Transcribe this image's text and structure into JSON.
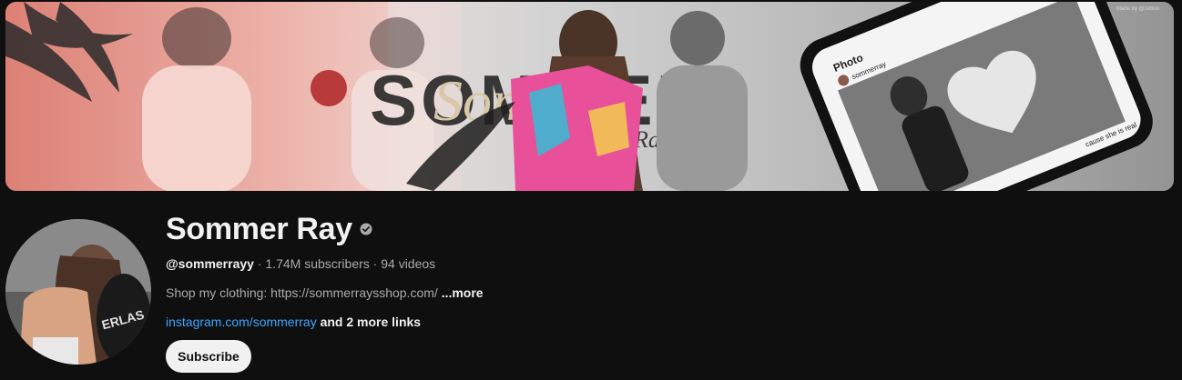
{
  "banner": {
    "wordmark": "SOMMER",
    "script_word": "Sommer",
    "script_sub": "Ray",
    "phone_header": "Photo",
    "phone_username": "sommerray",
    "phone_caption": "cause she is real",
    "watermark": "Made by @zeboo",
    "colors": {
      "left_tint": "#e58e82",
      "right_tint": "#9e9e9e"
    }
  },
  "channel": {
    "name": "Sommer Ray",
    "verified_icon": "verified-check-icon",
    "handle": "@sommerrayy",
    "subscribers": "1.74M subscribers",
    "videos": "94 videos",
    "separator": " · ",
    "description": "Shop my clothing: https://sommerraysshop.com/ ",
    "more_label": "...more",
    "link": "instagram.com/sommerray",
    "more_links": " and 2 more links",
    "subscribe_label": "Subscribe"
  },
  "colors": {
    "background": "#0f0f0f",
    "text_primary": "#f1f1f1",
    "text_secondary": "#aaaaaa",
    "link": "#3ea6ff",
    "button_bg": "#f1f1f1"
  }
}
